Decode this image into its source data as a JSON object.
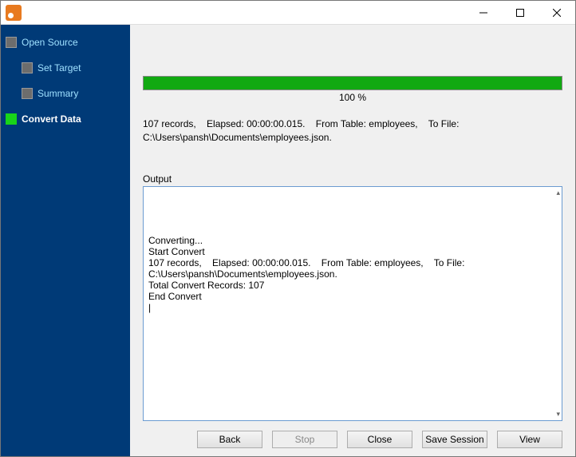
{
  "titlebar": {
    "title": ""
  },
  "sidebar": {
    "items": [
      {
        "label": "Open Source",
        "level": 0,
        "state": "completed"
      },
      {
        "label": "Set Target",
        "level": 1,
        "state": "completed"
      },
      {
        "label": "Summary",
        "level": 1,
        "state": "completed"
      },
      {
        "label": "Convert Data",
        "level": 0,
        "state": "current"
      }
    ]
  },
  "progress": {
    "percent": 100,
    "label": "100 %"
  },
  "status_text": "107 records,    Elapsed: 00:00:00.015.    From Table: employees,    To File: C:\\Users\\pansh\\Documents\\employees.json.",
  "output_label": "Output",
  "output_lines": [
    "Converting...",
    "Start Convert",
    "107 records,    Elapsed: 00:00:00.015.    From Table: employees,    To File: C:\\Users\\pansh\\Documents\\employees.json.",
    "Total Convert Records: 107",
    "End Convert"
  ],
  "buttons": {
    "back": "Back",
    "stop": "Stop",
    "close": "Close",
    "save_session": "Save Session",
    "view": "View"
  },
  "colors": {
    "sidebar_bg": "#003a77",
    "progress_fill": "#11a911",
    "accent_border": "#6b9bd1"
  }
}
